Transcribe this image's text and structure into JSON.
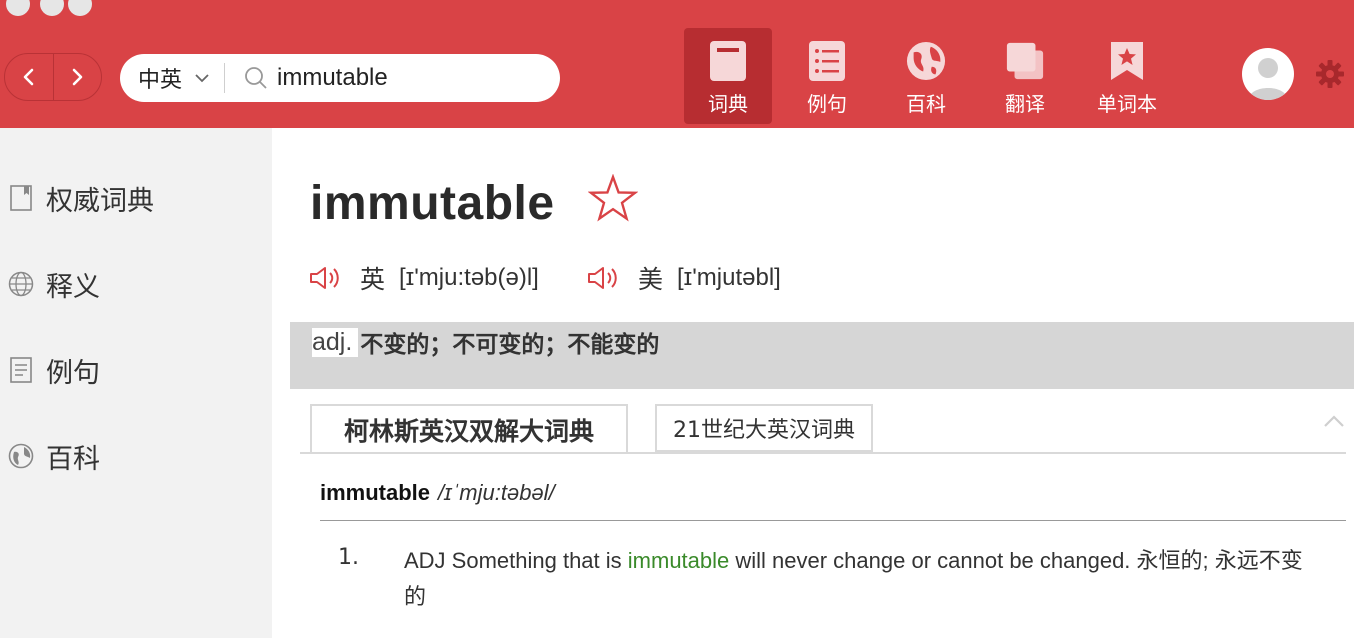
{
  "header": {
    "lang_select": "中英",
    "search": {
      "value": "immutable",
      "placeholder": ""
    },
    "tools": [
      {
        "label": "词典",
        "icon": "dictionary-icon",
        "active": true
      },
      {
        "label": "例句",
        "icon": "list-icon",
        "active": false
      },
      {
        "label": "百科",
        "icon": "globe-icon",
        "active": false
      },
      {
        "label": "翻译",
        "icon": "translate-icon",
        "active": false
      },
      {
        "label": "单词本",
        "icon": "bookmark-star-icon",
        "active": false
      }
    ],
    "colors": {
      "bar": "#d94346",
      "active_tool": "#b72d31"
    }
  },
  "sidebar": {
    "items": [
      {
        "label": "权威词典",
        "icon": "book-icon"
      },
      {
        "label": "释义",
        "icon": "globe-icon"
      },
      {
        "label": "例句",
        "icon": "document-icon"
      },
      {
        "label": "百科",
        "icon": "compass-icon"
      }
    ]
  },
  "word": {
    "headword": "immutable",
    "favorited": false,
    "pron_uk": {
      "region": "英",
      "ipa": "[ɪ'mju:təb(ə)l]"
    },
    "pron_us": {
      "region": "美",
      "ipa": "[ɪ'mjutəbl]"
    },
    "pos": "adj.",
    "meaning": "不变的；不可变的；不能变的"
  },
  "dict_tabs": [
    "柯林斯英汉双解大词典",
    "21世纪大英汉词典"
  ],
  "entry": {
    "word": "immutable",
    "ipa": "/ɪˈmju:təbəl/",
    "senses": [
      {
        "num": "1.",
        "pre": "ADJ Something that is ",
        "highlight": "immutable",
        "post": " will never change or cannot be changed. 永恒的; 永远不变的",
        "highlight_color": "#3a8a2a"
      }
    ]
  }
}
